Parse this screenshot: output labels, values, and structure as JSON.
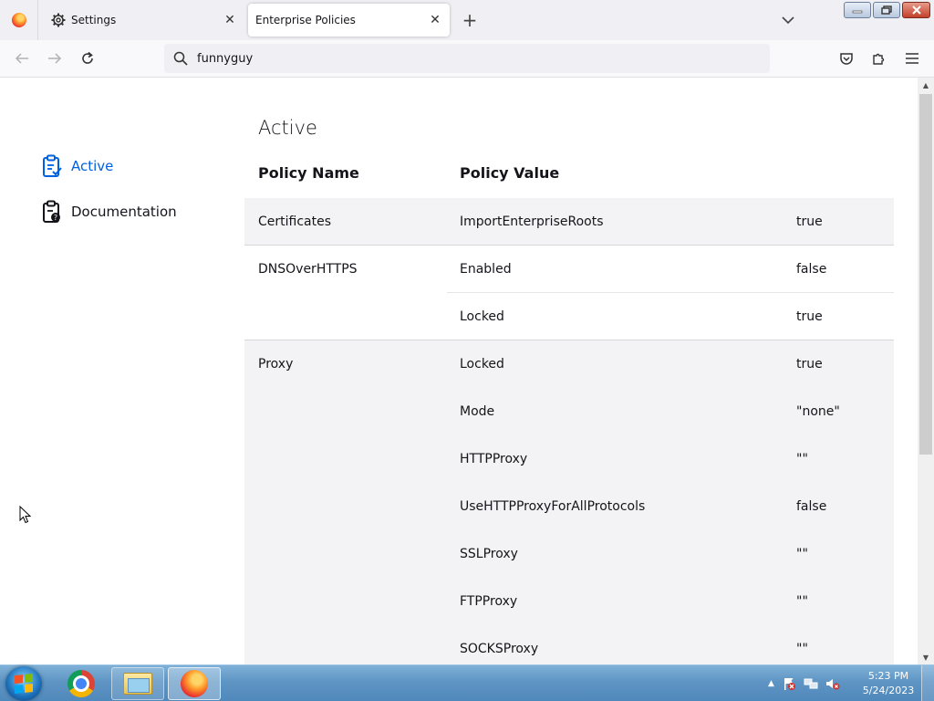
{
  "window": {
    "tabs": [
      {
        "title": "Settings",
        "icon": "gear-icon",
        "active": false
      },
      {
        "title": "Enterprise Policies",
        "active": true
      }
    ],
    "close_glyph": "✕",
    "new_tab_glyph": "+"
  },
  "navbar": {
    "url": "funnyguy"
  },
  "sidebar": {
    "items": [
      {
        "label": "Active",
        "icon": "clipboard-check-icon",
        "selected": true
      },
      {
        "label": "Documentation",
        "icon": "clipboard-help-icon",
        "selected": false
      }
    ]
  },
  "main": {
    "section_title": "Active",
    "columns": {
      "name": "Policy Name",
      "value": "Policy Value"
    },
    "policies": [
      {
        "name": "Certificates",
        "key": "ImportEnterpriseRoots",
        "value": "true"
      },
      {
        "name": "DNSOverHTTPS",
        "key": "Enabled",
        "value": "false"
      },
      {
        "name": "",
        "key": "Locked",
        "value": "true"
      },
      {
        "name": "Proxy",
        "key": "Locked",
        "value": "true"
      },
      {
        "name": "",
        "key": "Mode",
        "value": "\"none\""
      },
      {
        "name": "",
        "key": "HTTPProxy",
        "value": "\"\""
      },
      {
        "name": "",
        "key": "UseHTTPProxyForAllProtocols",
        "value": "false"
      },
      {
        "name": "",
        "key": "SSLProxy",
        "value": "\"\""
      },
      {
        "name": "",
        "key": "FTPProxy",
        "value": "\"\""
      },
      {
        "name": "",
        "key": "SOCKSProxy",
        "value": "\"\""
      }
    ]
  },
  "taskbar": {
    "apps": [
      "Google Chrome",
      "Windows Explorer",
      "Firefox"
    ],
    "clock": {
      "time": "5:23 PM",
      "date": "5/24/2023"
    }
  },
  "colors": {
    "accent": "#0061e0",
    "row_shade": "#f3f3f5"
  }
}
